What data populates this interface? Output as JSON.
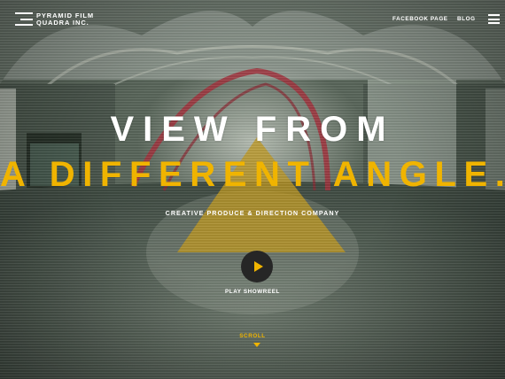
{
  "brand": {
    "line1": "PYRAMID FILM",
    "line2": "QUADRA INC."
  },
  "nav": {
    "facebook": "FACEBOOK PAGE",
    "blog": "BLOG",
    "menu_icon": "hamburger-menu-icon"
  },
  "hero": {
    "headline_line1": "VIEW FROM",
    "headline_line2": "A DIFFERENT ANGLE.",
    "tagline": "CREATIVE PRODUCE & DIRECTION COMPANY",
    "play_label": "PLAY SHOWREEL",
    "scroll_label": "SCROLL"
  },
  "colors": {
    "accent": "#f0b400",
    "text": "#ffffff",
    "play_bg": "#262626"
  }
}
